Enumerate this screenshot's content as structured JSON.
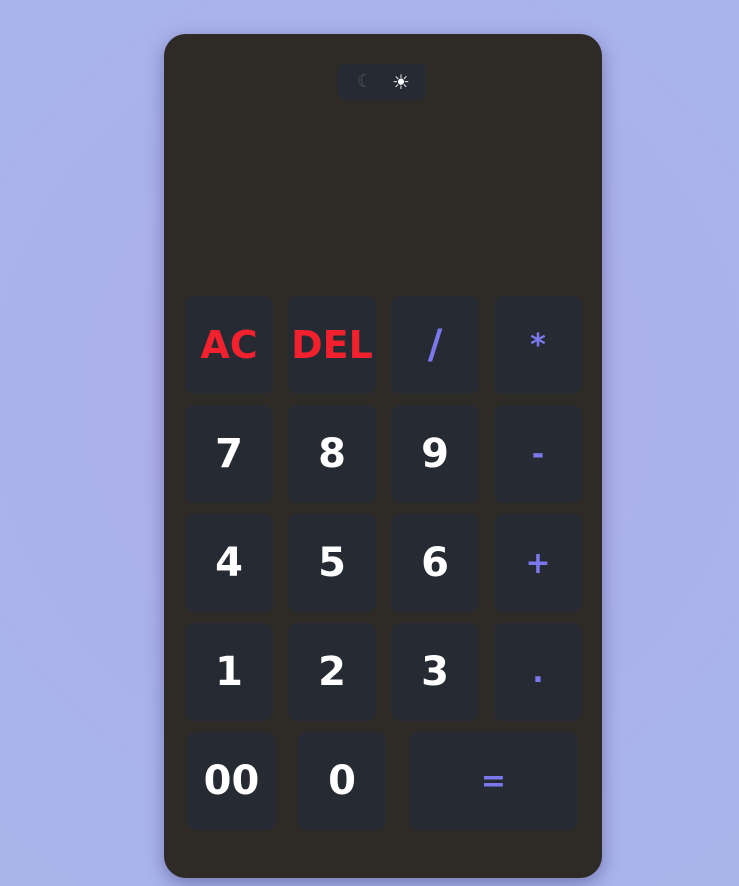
{
  "theme_toggle": {
    "dark_icon": "☾",
    "light_icon": "☀",
    "dark_icon_name": "moon-icon",
    "light_icon_name": "sun-icon",
    "active": "light"
  },
  "display": {
    "expression": "",
    "result": ""
  },
  "keys": {
    "clear": "AC",
    "delete": "DEL",
    "divide": "/",
    "multiply": "*",
    "seven": "7",
    "eight": "8",
    "nine": "9",
    "subtract": "-",
    "four": "4",
    "five": "5",
    "six": "6",
    "add": "+",
    "one": "1",
    "two": "2",
    "three": "3",
    "decimal": ".",
    "double_zero": "00",
    "zero": "0",
    "equals": "="
  },
  "colors": {
    "page_background": "#aab2ea",
    "calculator_body": "#2e2a25",
    "key_background": "#262a33",
    "digit_text": "#ffffff",
    "operator_text": "#7b78ed",
    "danger_text": "#f3212d"
  }
}
